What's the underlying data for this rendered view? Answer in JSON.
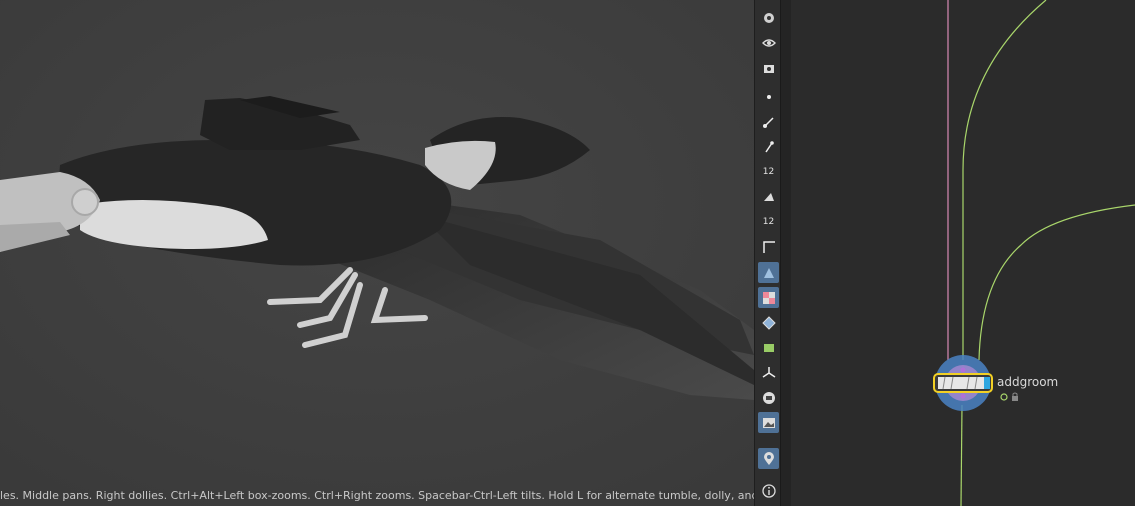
{
  "viewport": {
    "status_text": "les. Middle pans. Right dollies. Ctrl+Alt+Left box-zooms. Ctrl+Right zooms. Spacebar-Ctrl-Left tilts. Hold L for alternate tumble, dolly, and zoom. M or"
  },
  "toolbar": {
    "items": [
      {
        "name": "render-view-icon",
        "active": true
      },
      {
        "name": "visibility-eye-icon",
        "active": false
      },
      {
        "name": "camera-icon",
        "active": false
      },
      {
        "name": "point-display-icon",
        "active": false
      },
      {
        "name": "normal-display-icon",
        "active": false
      },
      {
        "name": "vertex-normal-icon",
        "active": false
      },
      {
        "name": "point-numbers-icon",
        "active": false,
        "badge": "12"
      },
      {
        "name": "primitive-icon",
        "active": false
      },
      {
        "name": "primitive-numbers-icon",
        "active": false,
        "badge": "12"
      },
      {
        "name": "border-icon",
        "active": false
      },
      {
        "name": "shaded-icon",
        "active": true
      },
      {
        "name": "checker-icon",
        "active": true
      },
      {
        "name": "wireframe-icon",
        "active": false
      },
      {
        "name": "uv-icon",
        "active": false
      },
      {
        "name": "snap-icon",
        "active": false
      },
      {
        "name": "ghost-icon",
        "active": false
      },
      {
        "name": "background-image-icon",
        "active": true
      },
      {
        "name": "pin-icon",
        "active": true
      },
      {
        "name": "info-icon",
        "active": false
      }
    ]
  },
  "network": {
    "node": {
      "label": "addgroom"
    },
    "colors": {
      "wire": "#a9d66b",
      "pink_wire": "#d88ab4",
      "node_outline": "#f2d024",
      "node_glow": "#4a82c4"
    }
  }
}
